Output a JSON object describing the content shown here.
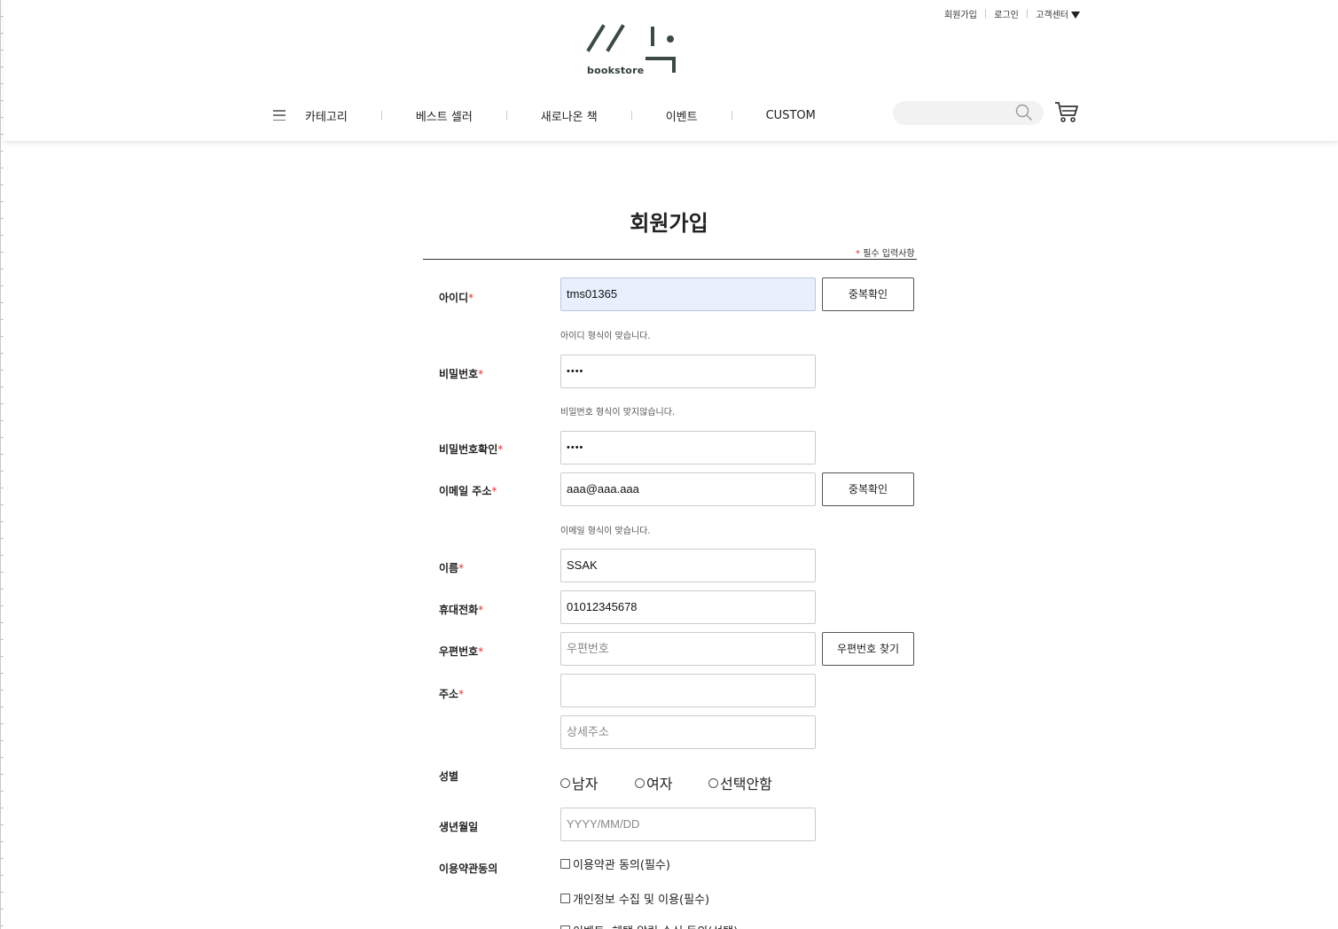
{
  "top_links": [
    "회원가입",
    "로그인",
    "고객센터"
  ],
  "logo": {
    "brand_text": "bookstore"
  },
  "nav": {
    "items": [
      "카테고리",
      "베스트 셀러",
      "새로나온 책",
      "이벤트",
      "CUSTOM"
    ]
  },
  "search": {
    "placeholder": ""
  },
  "page": {
    "title": "회원가입",
    "required_note": "필수 입력사항",
    "required_mark": "*"
  },
  "form": {
    "id": {
      "label": "아이디",
      "value": "tms01365",
      "button": "중복확인",
      "hint": "아이디 형식이 맞습니다."
    },
    "password": {
      "label": "비밀번호",
      "value": "••••",
      "hint": "비밀번호 형식이 맞지않습니다."
    },
    "password_confirm": {
      "label": "비밀번호확인",
      "value": "••••"
    },
    "email": {
      "label": "이메일 주소",
      "value": "aaa@aaa.aaa",
      "button": "중복확인",
      "hint": "이메일 형식이 맞습니다."
    },
    "name": {
      "label": "이름",
      "value": "SSAK"
    },
    "phone": {
      "label": "휴대전화",
      "value": "01012345678"
    },
    "postcode": {
      "label": "우편번호",
      "placeholder": "우편번호",
      "button": "우편번호 찾기"
    },
    "address": {
      "label": "주소",
      "value": "",
      "detail_placeholder": "상세주소"
    },
    "gender": {
      "label": "성별",
      "options": [
        "남자",
        "여자",
        "선택안함"
      ]
    },
    "birth": {
      "label": "생년월일",
      "placeholder": "YYYY/MM/DD"
    },
    "terms": {
      "label": "이용약관동의",
      "items": [
        "이용약관 동의(필수)",
        "개인정보 수집 및 이용(필수)",
        "이벤트, 혜택 알림 수신 동의(선택)"
      ]
    }
  }
}
